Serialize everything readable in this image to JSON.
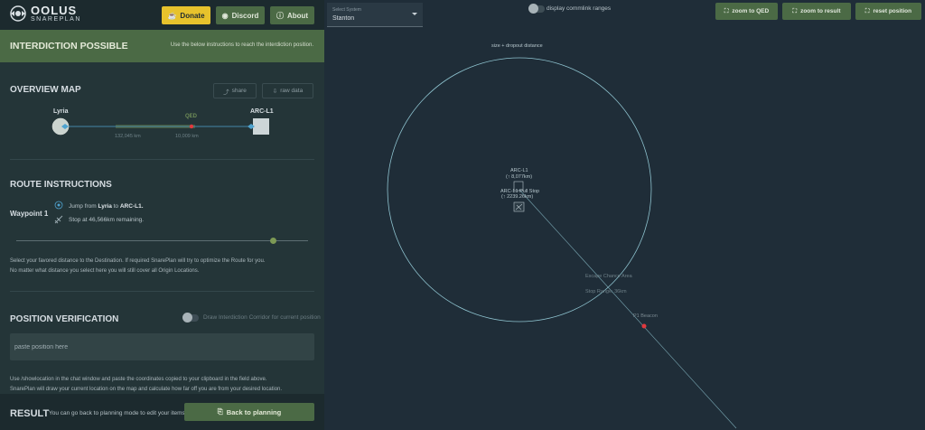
{
  "header": {
    "logo_title": "OOLUS",
    "logo_subtitle": "SNAREPLAN",
    "donate_label": "Donate",
    "discord_label": "Discord",
    "about_label": "About"
  },
  "banner": {
    "title": "INTERDICTION POSSIBLE",
    "note": "Use the below instructions to reach the interdiction position."
  },
  "overview": {
    "title": "OVERVIEW MAP",
    "share_label": "share",
    "raw_label": "raw data",
    "origin": "Lyria",
    "destination": "ARC-L1",
    "qed_label": "QED",
    "dist_left": "132,045 km",
    "dist_right": "10,009 km"
  },
  "route": {
    "title": "ROUTE INSTRUCTIONS",
    "waypoint": "Waypoint 1",
    "jump_prefix": "Jump from",
    "jump_from": "Lyria",
    "jump_to_word": "to",
    "jump_to": "ARC-L1.",
    "stop_text": "Stop at 46,566km remaining.",
    "slider_fraction": 0.88,
    "help_line1": "Select your favored distance to the Destination. If required SnarePlan will try to optimize the Route for you.",
    "help_line2": "No matter what distance you select here you will still cover all Origin Locations."
  },
  "verification": {
    "title": "POSITION VERIFICATION",
    "toggle_label": "Draw Interdiction Corridor for current position",
    "input_placeholder": "paste position here",
    "help_line1": "Use /showlocation in the chat window and paste the coordinates copied to your clipboard in the field above.",
    "help_line2": "SnarePlan will draw your current location on the map and calculate how far off you are from your desired location."
  },
  "result": {
    "title": "RESULT",
    "note": "You can go back to planning mode to edit your items.",
    "back_label": "Back to planning"
  },
  "map": {
    "select_caption": "Select System",
    "select_value": "Stanton",
    "commlink_label": "display commlink ranges",
    "zoom_qed_label": "zoom to QED",
    "zoom_result_label": "zoom to result",
    "reset_label": "reset position",
    "circle_label": "size + dropout distance",
    "arc_name": "ARC-L1",
    "arc_dist": "(↑ 8,077km)",
    "marker_name": "ARC-L1 Pull Stop",
    "marker_dist": "(↑ 2239.26km)",
    "escape_label": "Escape Chance Area",
    "range_label": "Stop Range: 36km",
    "p1_label": "P1 Beacon",
    "accent": "#8ec3cf",
    "red": "#e0393e"
  }
}
